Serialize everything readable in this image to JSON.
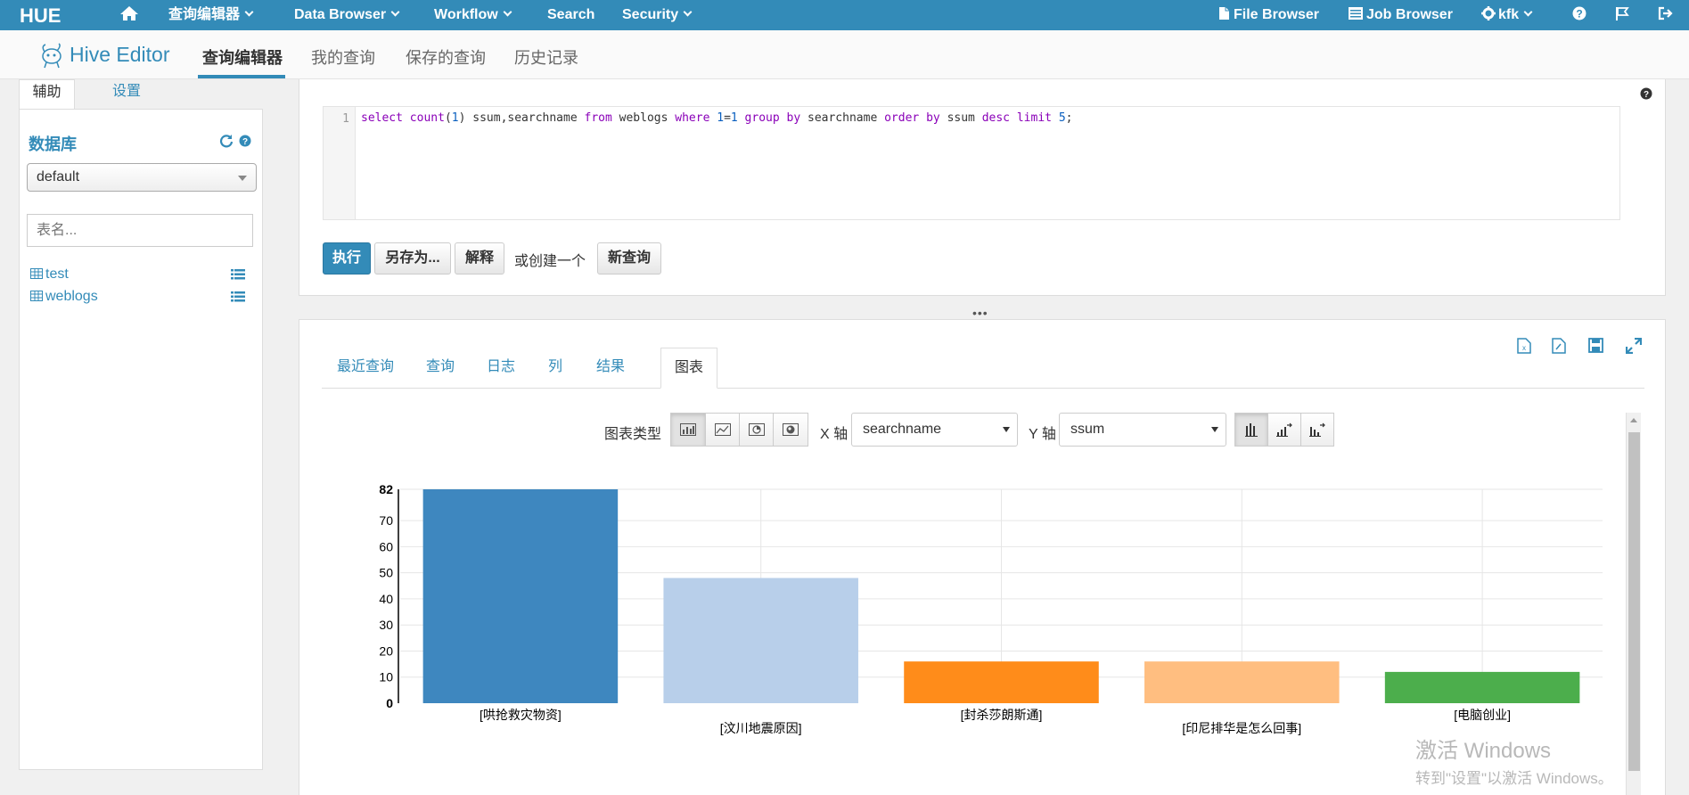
{
  "topnav": {
    "logo_text": "HUE",
    "query_editors": "查询编辑器",
    "data_browser": "Data Browser",
    "workflow": "Workflow",
    "search": "Search",
    "security": "Security",
    "file_browser": "File Browser",
    "job_browser": "Job Browser",
    "user": "kfk",
    "bg_color": "#338bb8"
  },
  "subnav": {
    "app_title": "Hive Editor",
    "tabs": [
      "查询编辑器",
      "我的查询",
      "保存的查询",
      "历史记录"
    ],
    "active_tab": "查询编辑器"
  },
  "left_panel": {
    "tabs": [
      "辅助",
      "设置"
    ],
    "active_tab": "辅助",
    "database_title": "数据库",
    "database_selected": "default",
    "table_filter_placeholder": "表名...",
    "tables": [
      "test",
      "weblogs"
    ]
  },
  "editor": {
    "line_number": "1",
    "query": "select count(1) ssum,searchname from weblogs where 1=1 group by searchname order by ssum desc limit 5;",
    "buttons": {
      "execute": "执行",
      "save_as": "另存为...",
      "explain": "解释",
      "or_create": "或创建一个",
      "new_query": "新查询"
    }
  },
  "results": {
    "tabs": [
      "最近查询",
      "查询",
      "日志",
      "列",
      "结果",
      "图表"
    ],
    "active_tab": "图表",
    "chart_type_label": "图表类型",
    "x_axis_label": "X 轴",
    "x_axis_value": "searchname",
    "y_axis_label": "Y 轴",
    "y_axis_value": "ssum"
  },
  "chart_data": {
    "type": "bar",
    "categories": [
      "[哄抢救灾物资]",
      "[汶川地震原因]",
      "[封杀莎朗斯通]",
      "[印尼排华是怎么回事]",
      "[电脑创业]"
    ],
    "values": [
      82,
      48,
      16,
      16,
      12
    ],
    "colors": [
      "#3e87bf",
      "#b8cfea",
      "#ff8c1a",
      "#ffbe80",
      "#4cae4c"
    ],
    "ylim": [
      0,
      82
    ],
    "yticks": [
      0,
      10,
      20,
      30,
      40,
      50,
      60,
      70,
      82
    ],
    "grid": true,
    "xlabel": "",
    "ylabel": ""
  },
  "watermark": {
    "line1": "激活 Windows",
    "line2": "转到\"设置\"以激活 Windows。"
  }
}
